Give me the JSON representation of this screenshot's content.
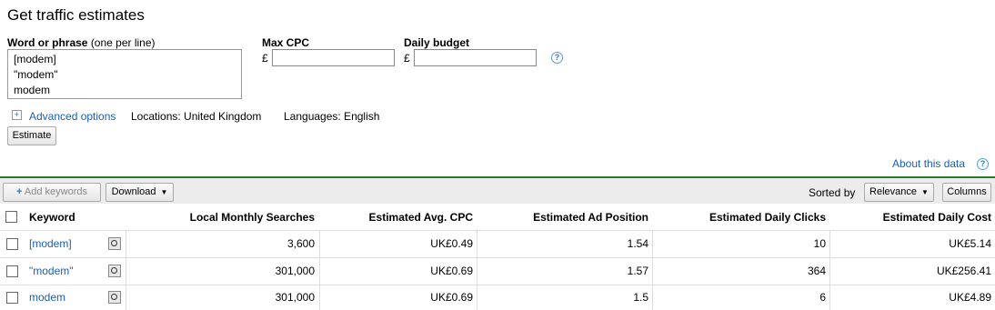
{
  "page": {
    "title": "Get traffic estimates"
  },
  "form": {
    "words_label": "Word or phrase",
    "words_sublabel": "(one per line)",
    "words_value": "[modem]\n\"modem\"\nmodem",
    "maxcpc_label": "Max CPC",
    "budget_label": "Daily budget",
    "currency": "£",
    "advanced": "Advanced options",
    "locations": "Locations: United Kingdom",
    "languages": "Languages: English",
    "estimate_btn": "Estimate"
  },
  "about": "About this data",
  "toolbar": {
    "add_keywords": "Add keywords",
    "download": "Download",
    "sorted_by": "Sorted by",
    "sort_value": "Relevance",
    "columns": "Columns"
  },
  "table": {
    "headers": [
      "Keyword",
      "Local Monthly Searches",
      "Estimated Avg. CPC",
      "Estimated Ad Position",
      "Estimated Daily Clicks",
      "Estimated Daily Cost"
    ],
    "rows": [
      {
        "keyword": "[modem]",
        "searches": "3,600",
        "cpc": "UK£0.49",
        "position": "1.54",
        "clicks": "10",
        "cost": "UK£5.14"
      },
      {
        "keyword": "\"modem\"",
        "searches": "301,000",
        "cpc": "UK£0.69",
        "position": "1.57",
        "clicks": "364",
        "cost": "UK£256.41"
      },
      {
        "keyword": "modem",
        "searches": "301,000",
        "cpc": "UK£0.69",
        "position": "1.5",
        "clicks": "6",
        "cost": "UK£4.89"
      }
    ]
  },
  "colors": {
    "link": "#1a5fb4",
    "accent_rule": "#2b7a2b",
    "toolbar_bg": "#ececec"
  }
}
